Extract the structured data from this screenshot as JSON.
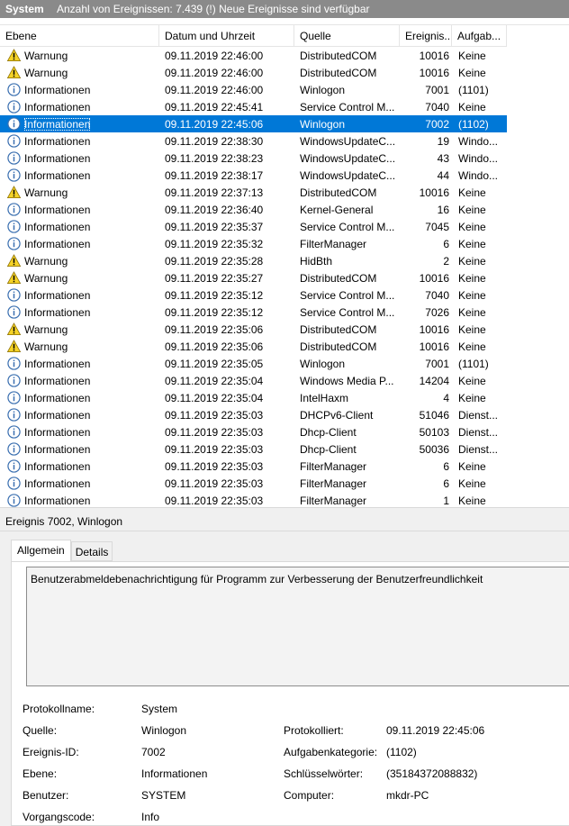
{
  "titlebar": {
    "name": "System",
    "info": "Anzahl von Ereignissen: 7.439 (!) Neue Ereignisse sind verfügbar"
  },
  "columns": {
    "level": "Ebene",
    "date": "Datum und Uhrzeit",
    "source": "Quelle",
    "id": "Ereignis...",
    "task": "Aufgab..."
  },
  "rows": [
    {
      "type": "warning",
      "level": "Warnung",
      "date": "09.11.2019 22:46:00",
      "source": "DistributedCOM",
      "id": "10016",
      "task": "Keine"
    },
    {
      "type": "warning",
      "level": "Warnung",
      "date": "09.11.2019 22:46:00",
      "source": "DistributedCOM",
      "id": "10016",
      "task": "Keine"
    },
    {
      "type": "info",
      "level": "Informationen",
      "date": "09.11.2019 22:46:00",
      "source": "Winlogon",
      "id": "7001",
      "task": "(1101)"
    },
    {
      "type": "info",
      "level": "Informationen",
      "date": "09.11.2019 22:45:41",
      "source": "Service Control M...",
      "id": "7040",
      "task": "Keine"
    },
    {
      "type": "info",
      "level": "Informationen",
      "date": "09.11.2019 22:45:06",
      "source": "Winlogon",
      "id": "7002",
      "task": "(1102)",
      "selected": true
    },
    {
      "type": "info",
      "level": "Informationen",
      "date": "09.11.2019 22:38:30",
      "source": "WindowsUpdateC...",
      "id": "19",
      "task": "Windo..."
    },
    {
      "type": "info",
      "level": "Informationen",
      "date": "09.11.2019 22:38:23",
      "source": "WindowsUpdateC...",
      "id": "43",
      "task": "Windo..."
    },
    {
      "type": "info",
      "level": "Informationen",
      "date": "09.11.2019 22:38:17",
      "source": "WindowsUpdateC...",
      "id": "44",
      "task": "Windo..."
    },
    {
      "type": "warning",
      "level": "Warnung",
      "date": "09.11.2019 22:37:13",
      "source": "DistributedCOM",
      "id": "10016",
      "task": "Keine"
    },
    {
      "type": "info",
      "level": "Informationen",
      "date": "09.11.2019 22:36:40",
      "source": "Kernel-General",
      "id": "16",
      "task": "Keine"
    },
    {
      "type": "info",
      "level": "Informationen",
      "date": "09.11.2019 22:35:37",
      "source": "Service Control M...",
      "id": "7045",
      "task": "Keine"
    },
    {
      "type": "info",
      "level": "Informationen",
      "date": "09.11.2019 22:35:32",
      "source": "FilterManager",
      "id": "6",
      "task": "Keine"
    },
    {
      "type": "warning",
      "level": "Warnung",
      "date": "09.11.2019 22:35:28",
      "source": "HidBth",
      "id": "2",
      "task": "Keine"
    },
    {
      "type": "warning",
      "level": "Warnung",
      "date": "09.11.2019 22:35:27",
      "source": "DistributedCOM",
      "id": "10016",
      "task": "Keine"
    },
    {
      "type": "info",
      "level": "Informationen",
      "date": "09.11.2019 22:35:12",
      "source": "Service Control M...",
      "id": "7040",
      "task": "Keine"
    },
    {
      "type": "info",
      "level": "Informationen",
      "date": "09.11.2019 22:35:12",
      "source": "Service Control M...",
      "id": "7026",
      "task": "Keine"
    },
    {
      "type": "warning",
      "level": "Warnung",
      "date": "09.11.2019 22:35:06",
      "source": "DistributedCOM",
      "id": "10016",
      "task": "Keine"
    },
    {
      "type": "warning",
      "level": "Warnung",
      "date": "09.11.2019 22:35:06",
      "source": "DistributedCOM",
      "id": "10016",
      "task": "Keine"
    },
    {
      "type": "info",
      "level": "Informationen",
      "date": "09.11.2019 22:35:05",
      "source": "Winlogon",
      "id": "7001",
      "task": "(1101)"
    },
    {
      "type": "info",
      "level": "Informationen",
      "date": "09.11.2019 22:35:04",
      "source": "Windows Media P...",
      "id": "14204",
      "task": "Keine"
    },
    {
      "type": "info",
      "level": "Informationen",
      "date": "09.11.2019 22:35:04",
      "source": "IntelHaxm",
      "id": "4",
      "task": "Keine"
    },
    {
      "type": "info",
      "level": "Informationen",
      "date": "09.11.2019 22:35:03",
      "source": "DHCPv6-Client",
      "id": "51046",
      "task": "Dienst..."
    },
    {
      "type": "info",
      "level": "Informationen",
      "date": "09.11.2019 22:35:03",
      "source": "Dhcp-Client",
      "id": "50103",
      "task": "Dienst..."
    },
    {
      "type": "info",
      "level": "Informationen",
      "date": "09.11.2019 22:35:03",
      "source": "Dhcp-Client",
      "id": "50036",
      "task": "Dienst..."
    },
    {
      "type": "info",
      "level": "Informationen",
      "date": "09.11.2019 22:35:03",
      "source": "FilterManager",
      "id": "6",
      "task": "Keine"
    },
    {
      "type": "info",
      "level": "Informationen",
      "date": "09.11.2019 22:35:03",
      "source": "FilterManager",
      "id": "6",
      "task": "Keine"
    },
    {
      "type": "info",
      "level": "Informationen",
      "date": "09.11.2019 22:35:03",
      "source": "FilterManager",
      "id": "1",
      "task": "Keine"
    }
  ],
  "icons": {
    "warning": "warning-icon",
    "info": "information-icon"
  },
  "colors": {
    "titlebar": "#8a8a8a",
    "selection": "#0078d7",
    "warning": "#f5d327",
    "info": "#3a6fb0"
  },
  "detail": {
    "header": "Ereignis 7002, Winlogon",
    "tabs": [
      "Allgemein",
      "Details"
    ],
    "message": "Benutzerabmeldebenachrichtigung für Programm zur Verbesserung der Benutzerfreundlichkeit",
    "labels": {
      "log_name": "Protokollname:",
      "source": "Quelle:",
      "event_id": "Ereignis-ID:",
      "level": "Ebene:",
      "user": "Benutzer:",
      "opcode": "Vorgangscode:",
      "logged": "Protokolliert:",
      "task_category": "Aufgabenkategorie:",
      "keywords": "Schlüsselwörter:",
      "computer": "Computer:"
    },
    "values": {
      "log_name": "System",
      "source": "Winlogon",
      "event_id": "7002",
      "level": "Informationen",
      "user": "SYSTEM",
      "opcode": "Info",
      "logged": "09.11.2019 22:45:06",
      "task_category": "(1102)",
      "keywords": "(35184372088832)",
      "computer": "mkdr-PC"
    }
  }
}
